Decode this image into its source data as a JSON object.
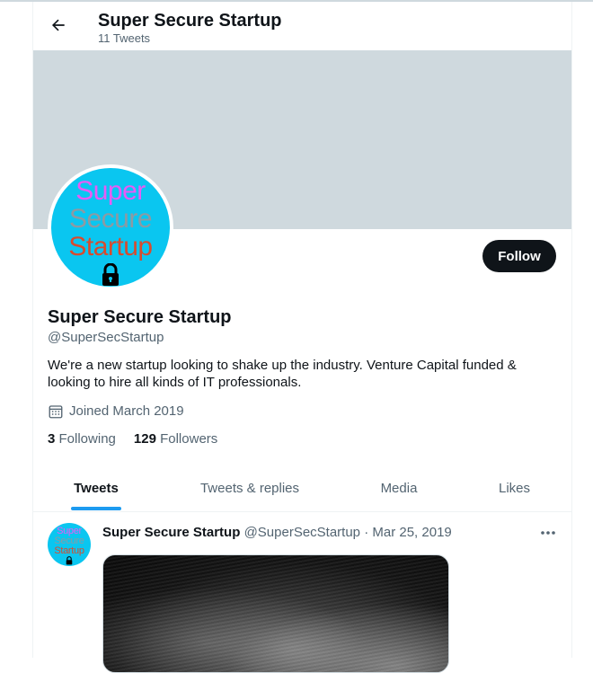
{
  "header": {
    "title": "Super Secure Startup",
    "tweet_count": "11 Tweets"
  },
  "avatar_logo": {
    "line1": "Super",
    "line2": "Secure",
    "line3": "Startup"
  },
  "profile": {
    "follow_label": "Follow",
    "name": "Super Secure Startup",
    "handle": "@SuperSecStartup",
    "bio": "We're a new startup looking to shake up the industry. Venture Capital funded & looking to hire all kinds of IT professionals.",
    "joined": "Joined March 2019",
    "following_count": "3",
    "following_label": "Following",
    "followers_count": "129",
    "followers_label": "Followers"
  },
  "tabs": [
    {
      "label": "Tweets",
      "active": true
    },
    {
      "label": "Tweets & replies",
      "active": false
    },
    {
      "label": "Media",
      "active": false
    },
    {
      "label": "Likes",
      "active": false
    }
  ],
  "tweet": {
    "author_name": "Super Secure Startup",
    "author_handle": "@SuperSecStartup",
    "separator": "·",
    "date": "Mar 25, 2019"
  },
  "colors": {
    "banner": "#cfd9de",
    "accent": "#1d9bf0",
    "avatar_bg": "#0ac6f0",
    "follow_bg": "#0f1419"
  },
  "icons": {
    "back": "arrow-left-icon",
    "calendar": "calendar-icon",
    "more": "more-horizontal-icon",
    "lock": "lock-icon"
  }
}
